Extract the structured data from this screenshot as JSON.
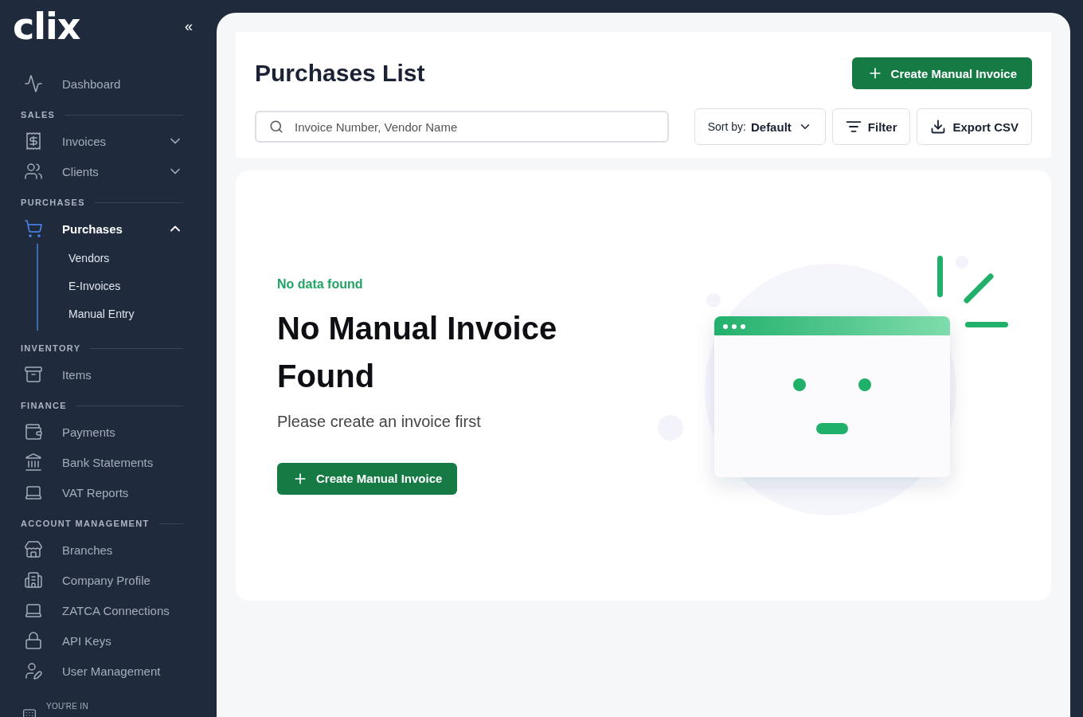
{
  "sidebar": {
    "logo": "clix",
    "collapse_icon": "«",
    "sections": [
      {
        "items": [
          {
            "label": "Dashboard",
            "selected": false
          }
        ]
      },
      {
        "title": "SALES",
        "items": [
          {
            "label": "Invoices",
            "selected": false,
            "expanded": false
          },
          {
            "label": "Clients",
            "selected": false,
            "expanded": false
          }
        ]
      },
      {
        "title": "PURCHASES",
        "items": [
          {
            "label": "Purchases",
            "selected": true,
            "expanded": true,
            "children": [
              {
                "label": "Vendors",
                "selected": false
              },
              {
                "label": "E-Invoices",
                "selected": false
              },
              {
                "label": "Manual Entry",
                "selected": false
              }
            ]
          }
        ]
      },
      {
        "title": "INVENTORY",
        "items": [
          {
            "label": "Items",
            "selected": false
          }
        ]
      },
      {
        "title": "FINANCE",
        "items": [
          {
            "label": "Payments",
            "selected": false
          },
          {
            "label": "Bank Statements",
            "selected": false
          },
          {
            "label": "VAT Reports",
            "selected": false
          }
        ]
      },
      {
        "title": "ACCOUNT MANAGEMENT",
        "items": [
          {
            "label": "Branches",
            "selected": false
          },
          {
            "label": "Company Profile",
            "selected": false
          },
          {
            "label": "ZATCA Connections",
            "selected": false
          },
          {
            "label": "API Keys",
            "selected": false
          },
          {
            "label": "User Management",
            "selected": false
          }
        ]
      }
    ],
    "footer": {
      "caption": "YOU'RE IN"
    }
  },
  "header": {
    "title": "Purchases List",
    "primary_button": "Create Manual Invoice",
    "search": {
      "placeholder": "Invoice Number, Vendor Name"
    },
    "sort": {
      "label": "Sort by:",
      "value": "Default"
    },
    "buttons": [
      {
        "kind": "filter",
        "label": "Filter"
      },
      {
        "kind": "export",
        "label": "Export CSV"
      }
    ]
  },
  "empty_state": {
    "eyebrow": "No data found",
    "title": "No Manual Invoice Found",
    "description": "Please create an invoice first",
    "button": "Create Manual Invoice"
  }
}
